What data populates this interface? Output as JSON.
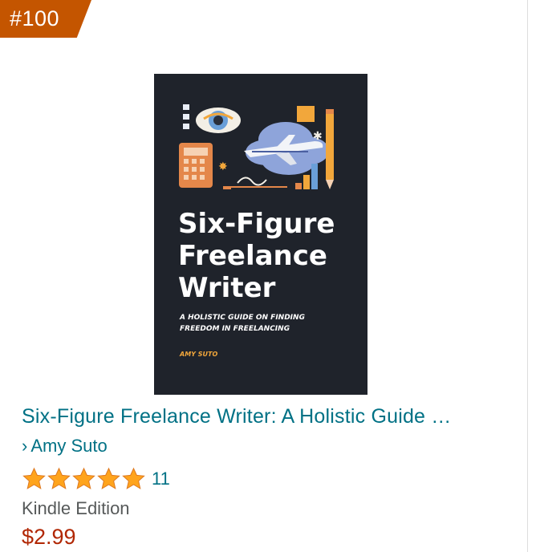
{
  "badge": {
    "rank": "#100"
  },
  "book": {
    "title": "Six-Figure Freelance Writer: A Holistic Guide …",
    "author": "Amy Suto",
    "author_chevron": "›",
    "rating_stars": 5,
    "rating_count": "11",
    "format": "Kindle Edition",
    "price": "$2.99"
  },
  "cover": {
    "title_lines": [
      "Six-Figure",
      "Freelance",
      "Writer"
    ],
    "subtitle_lines": [
      "A HOLISTIC GUIDE ON FINDING",
      "FREEDOM IN FREELANCING"
    ],
    "author": "AMY SUTO"
  },
  "colors": {
    "badge": "#c45500",
    "link": "#007185",
    "price": "#b12704",
    "star": "#ffa41c",
    "cover_bg": "#1f232b"
  }
}
